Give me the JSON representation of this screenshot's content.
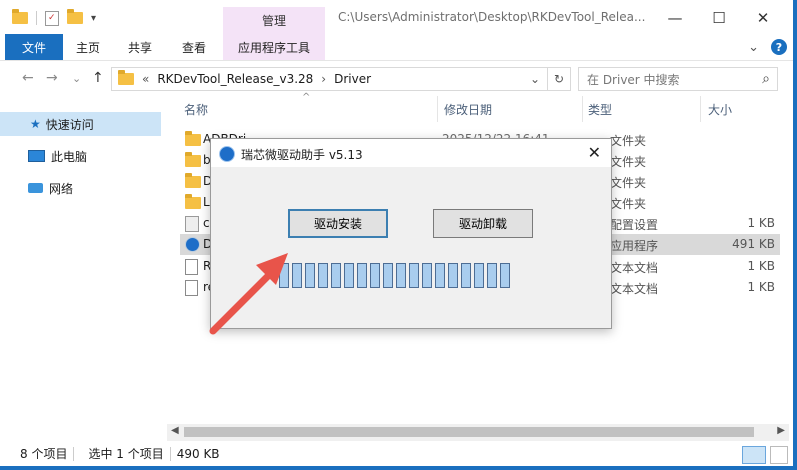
{
  "window": {
    "context_tab_label": "管理",
    "title": "C:\\Users\\Administrator\\Desktop\\RKDevTool_Relea...",
    "minimize": "—",
    "maximize": "☐",
    "close": "✕"
  },
  "ribbon": {
    "tabs": [
      "文件",
      "主页",
      "共享",
      "查看",
      "应用程序工具"
    ],
    "expand": "⌄",
    "help": "?"
  },
  "address": {
    "back": "←",
    "forward": "→",
    "recent": "⌄",
    "up": "↑",
    "overflow": "«",
    "crumbs": [
      "RKDevTool_Release_v3.28",
      "Driver"
    ],
    "sep": "›",
    "dropdown": "⌄",
    "refresh": "↻",
    "search_placeholder": "在 Driver 中搜索",
    "search_icon": "⌕"
  },
  "nav": {
    "items": [
      "快速访问",
      "此电脑",
      "网络"
    ]
  },
  "columns": {
    "name": "名称",
    "date": "修改日期",
    "type": "类型",
    "size": "大小"
  },
  "files": [
    {
      "name": "ADBDri",
      "date": "2025/12/22 16:41",
      "type": "文件夹",
      "size": ""
    },
    {
      "name": "bin",
      "date": "",
      "type": "文件夹",
      "size": ""
    },
    {
      "name": "Dr",
      "date": "",
      "type": "文件夹",
      "size": ""
    },
    {
      "name": "Lo",
      "date": "",
      "type": "文件夹",
      "size": ""
    },
    {
      "name": "co",
      "date": "",
      "type": "配置设置",
      "size": "1 KB"
    },
    {
      "name": "Dr",
      "date": "",
      "type": "应用程序",
      "size": "491 KB"
    },
    {
      "name": "Re",
      "date": "",
      "type": "文本文档",
      "size": "1 KB"
    },
    {
      "name": "re",
      "date": "",
      "type": "文本文档",
      "size": "1 KB"
    }
  ],
  "status": {
    "count": "8 个项目",
    "selected": "选中 1 个项目",
    "size": "490 KB"
  },
  "dialog": {
    "title": "瑞芯微驱动助手 v5.13",
    "close": "✕",
    "install_label": "驱动安装",
    "uninstall_label": "驱动卸载",
    "progress_fraction": 1.0,
    "progress_segments": 18
  },
  "colors": {
    "accent": "#1a6fbf",
    "context_tab": "#f4e3f7",
    "annotation_arrow": "#e8544a"
  },
  "icons": {
    "folder": "folder-icon",
    "app": "rockchip-app-icon",
    "document": "document-icon",
    "config": "config-file-icon",
    "star": "star-icon",
    "pc": "computer-icon",
    "network": "network-icon"
  }
}
